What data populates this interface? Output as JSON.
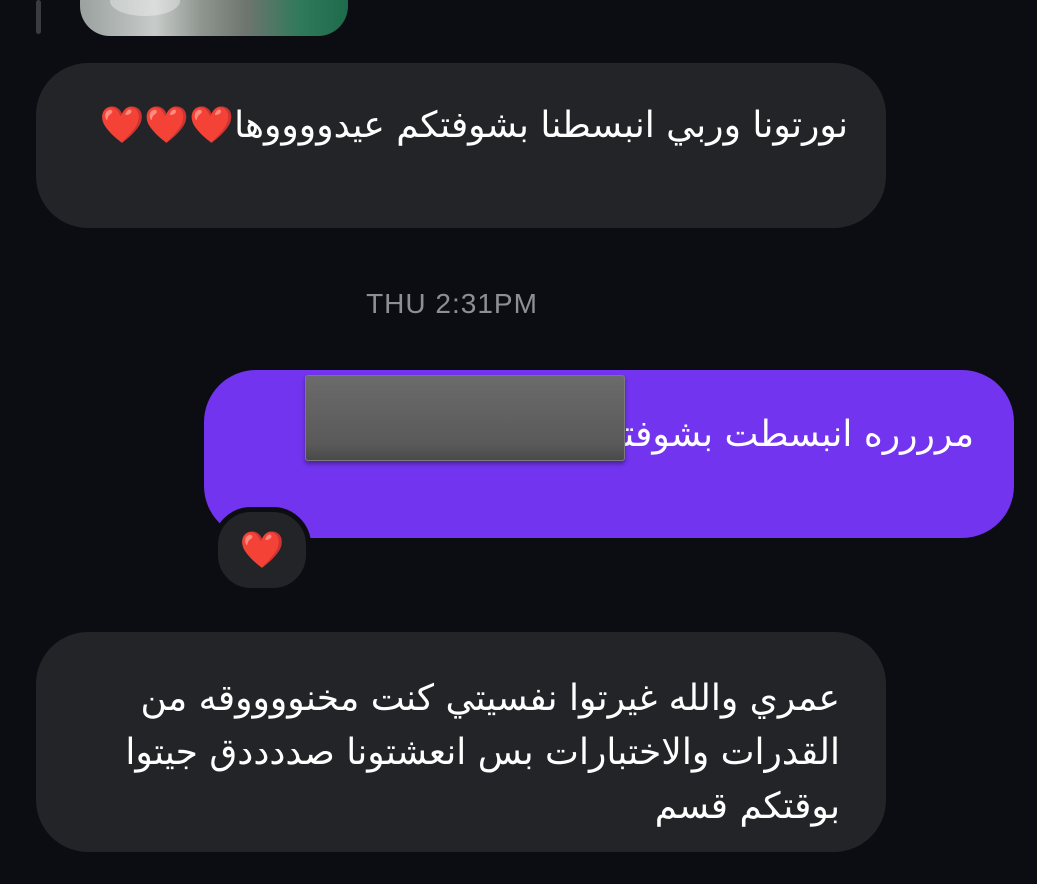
{
  "thread": {
    "timestamp": "THU 2:31PM"
  },
  "messages": [
    {
      "direction": "incoming",
      "text": "نورتونا وربي انبسطنا بشوفتكم عيدووووها❤️❤️❤️"
    },
    {
      "direction": "outgoing",
      "text": "مرررره انبسطت بشوفتـ",
      "text_suffix": " 🥺🤍🤍",
      "redacted": true,
      "reaction": "❤️"
    },
    {
      "direction": "incoming",
      "text": "عمري والله غيرتوا نفسيتي كنت مخنووووقه من القدرات والاختبارات بس انعشتونا صددددق جيتوا بوقتكم قسم"
    }
  ],
  "colors": {
    "background": "#0c0d12",
    "incoming_bubble": "#232428",
    "outgoing_bubble": "#7234ef",
    "timestamp": "#8e8f95"
  }
}
